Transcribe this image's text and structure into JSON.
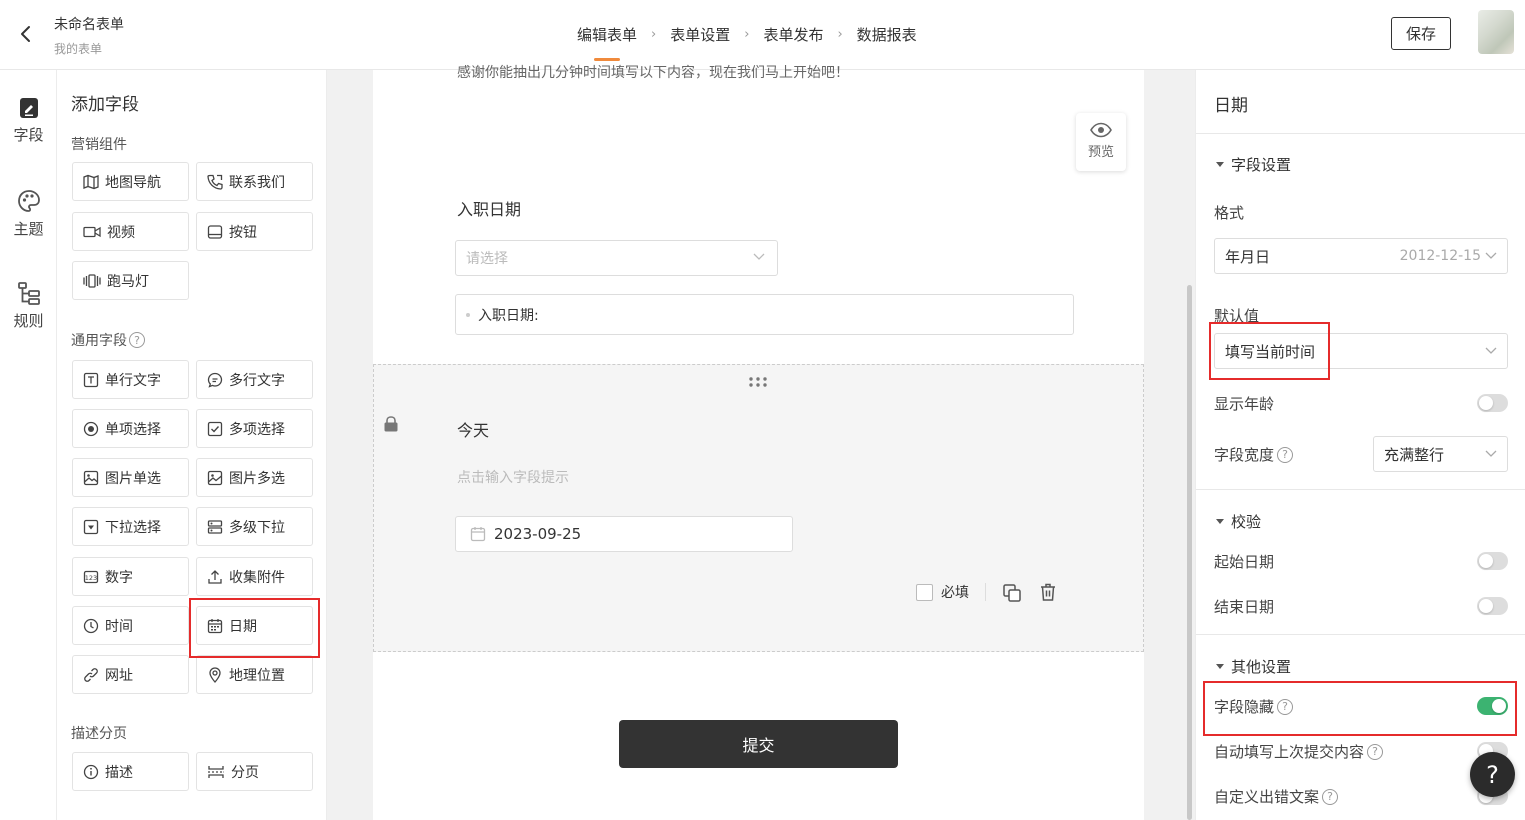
{
  "header": {
    "back_icon": "arrow-left-icon",
    "title": "未命名表单",
    "subtitle": "我的表单",
    "steps": [
      {
        "label": "编辑表单",
        "active": true
      },
      {
        "label": "表单设置",
        "active": false
      },
      {
        "label": "表单发布",
        "active": false
      },
      {
        "label": "数据报表",
        "active": false
      }
    ],
    "step_separator": "›",
    "save_label": "保存",
    "accent_color": "#f08a3c"
  },
  "rail": {
    "items": [
      {
        "label": "字段",
        "icon": "edit-doc-icon"
      },
      {
        "label": "主题",
        "icon": "palette-icon"
      },
      {
        "label": "规则",
        "icon": "tree-icon"
      }
    ]
  },
  "palette": {
    "title": "添加字段",
    "groups": [
      {
        "title": "营销组件",
        "items": [
          "地图导航",
          "联系我们",
          "视频",
          "按钮",
          "跑马灯"
        ]
      },
      {
        "title": "通用字段",
        "help": "?",
        "items": [
          "单行文字",
          "多行文字",
          "单项选择",
          "多项选择",
          "图片单选",
          "图片多选",
          "下拉选择",
          "多级下拉",
          "数字",
          "收集附件",
          "时间",
          "日期",
          "网址",
          "地理位置"
        ]
      },
      {
        "title": "描述分页",
        "items": [
          "描述",
          "分页"
        ]
      }
    ]
  },
  "canvas": {
    "intro_text": "感谢你能抽出几分钟时间填写以下内容，现在我们马上开始吧！",
    "preview_label": "预览",
    "q1": {
      "title": "入职日期",
      "placeholder": "请选择",
      "text_value": "入职日期:"
    },
    "q2": {
      "title": "今天",
      "hint": "点击输入字段提示",
      "date_value": "2023-09-25",
      "required_label": "必填"
    },
    "submit_label": "提交"
  },
  "props": {
    "title": "日期",
    "field_settings": {
      "section_label": "字段设置",
      "format_label": "格式",
      "format_value": "年月日",
      "format_example": "2012-12-15",
      "default_label": "默认值",
      "default_value": "填写当前时间",
      "show_age_label": "显示年龄",
      "show_age_on": false,
      "width_label": "字段宽度",
      "width_value": "充满整行"
    },
    "validation": {
      "section_label": "校验",
      "start_label": "起始日期",
      "start_on": false,
      "end_label": "结束日期",
      "end_on": false
    },
    "other": {
      "section_label": "其他设置",
      "hide_label": "字段隐藏",
      "hide_on": true,
      "autofill_label": "自动填写上次提交内容",
      "autofill_on": false,
      "custom_error_label": "自定义出错文案",
      "custom_error_on": false
    },
    "toggle_on_color": "#3cb371"
  },
  "help_fab": "?",
  "highlight_color": "#e52b2b"
}
